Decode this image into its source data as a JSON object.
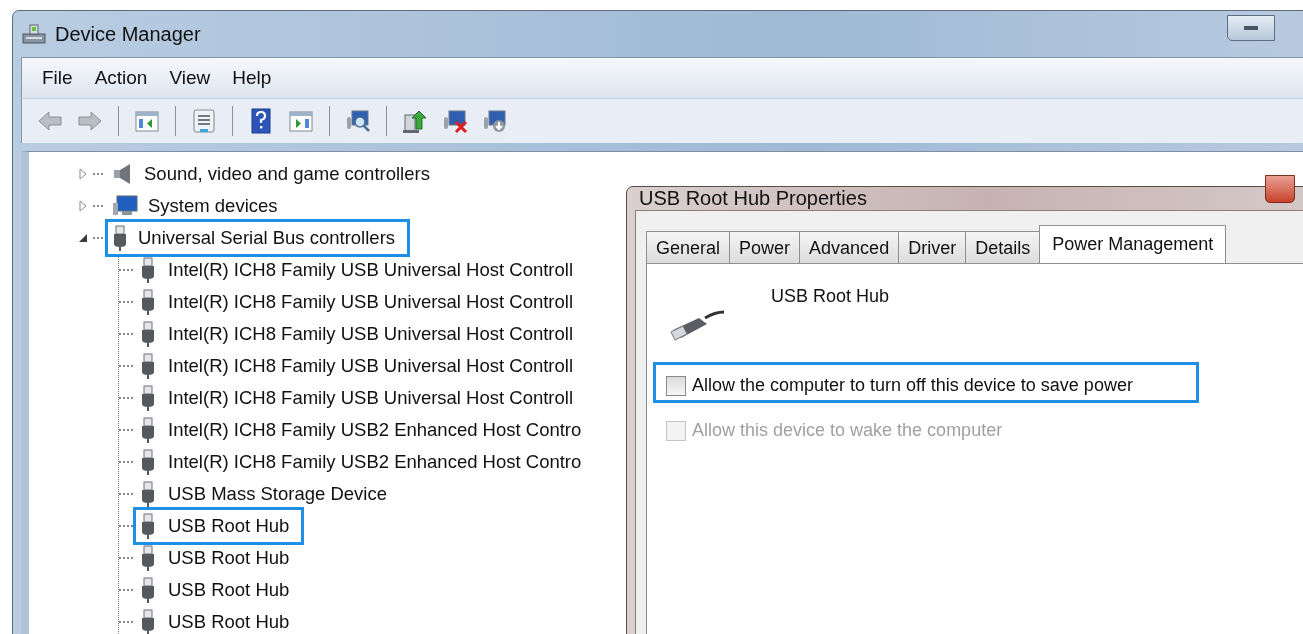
{
  "window": {
    "title": "Device Manager"
  },
  "menu": [
    "File",
    "Action",
    "View",
    "Help"
  ],
  "toolbar": [
    {
      "kind": "back",
      "disabled": true
    },
    {
      "kind": "forward",
      "disabled": true
    },
    {
      "kind": "sep"
    },
    {
      "kind": "tree-pane"
    },
    {
      "kind": "sep"
    },
    {
      "kind": "properties"
    },
    {
      "kind": "sep"
    },
    {
      "kind": "help"
    },
    {
      "kind": "action-pane"
    },
    {
      "kind": "sep"
    },
    {
      "kind": "scan"
    },
    {
      "kind": "sep"
    },
    {
      "kind": "update"
    },
    {
      "kind": "disable"
    },
    {
      "kind": "uninstall"
    }
  ],
  "tree": [
    {
      "label": "Sound, video and game controllers",
      "kind": "speaker",
      "expanded": false,
      "highlighted": false
    },
    {
      "label": "System devices",
      "kind": "monitor",
      "expanded": false,
      "highlighted": false
    },
    {
      "label": "Universal Serial Bus controllers",
      "kind": "usb",
      "expanded": true,
      "highlighted": true,
      "children": [
        {
          "label": "Intel(R) ICH8 Family USB Universal Host Controll",
          "highlighted": false
        },
        {
          "label": "Intel(R) ICH8 Family USB Universal Host Controll",
          "highlighted": false
        },
        {
          "label": "Intel(R) ICH8 Family USB Universal Host Controll",
          "highlighted": false
        },
        {
          "label": "Intel(R) ICH8 Family USB Universal Host Controll",
          "highlighted": false
        },
        {
          "label": "Intel(R) ICH8 Family USB Universal Host Controll",
          "highlighted": false
        },
        {
          "label": "Intel(R) ICH8 Family USB2 Enhanced Host Contro",
          "highlighted": false
        },
        {
          "label": "Intel(R) ICH8 Family USB2 Enhanced Host Contro",
          "highlighted": false
        },
        {
          "label": "USB Mass Storage Device",
          "highlighted": false
        },
        {
          "label": "USB Root Hub",
          "highlighted": true
        },
        {
          "label": "USB Root Hub",
          "highlighted": false
        },
        {
          "label": "USB Root Hub",
          "highlighted": false
        },
        {
          "label": "USB Root Hub",
          "highlighted": false
        }
      ]
    }
  ],
  "dialog": {
    "title": "USB Root Hub Properties",
    "tabs": [
      {
        "label": "General",
        "selected": false
      },
      {
        "label": "Power",
        "selected": false
      },
      {
        "label": "Advanced",
        "selected": false
      },
      {
        "label": "Driver",
        "selected": false
      },
      {
        "label": "Details",
        "selected": false
      },
      {
        "label": "Power Management",
        "selected": true
      }
    ],
    "device_name": "USB Root Hub",
    "options": [
      {
        "label": "Allow the computer to turn off this device to save power",
        "checked": false,
        "disabled": false,
        "highlighted": true
      },
      {
        "label": "Allow this device to wake the computer",
        "checked": false,
        "disabled": true,
        "highlighted": false
      }
    ]
  }
}
